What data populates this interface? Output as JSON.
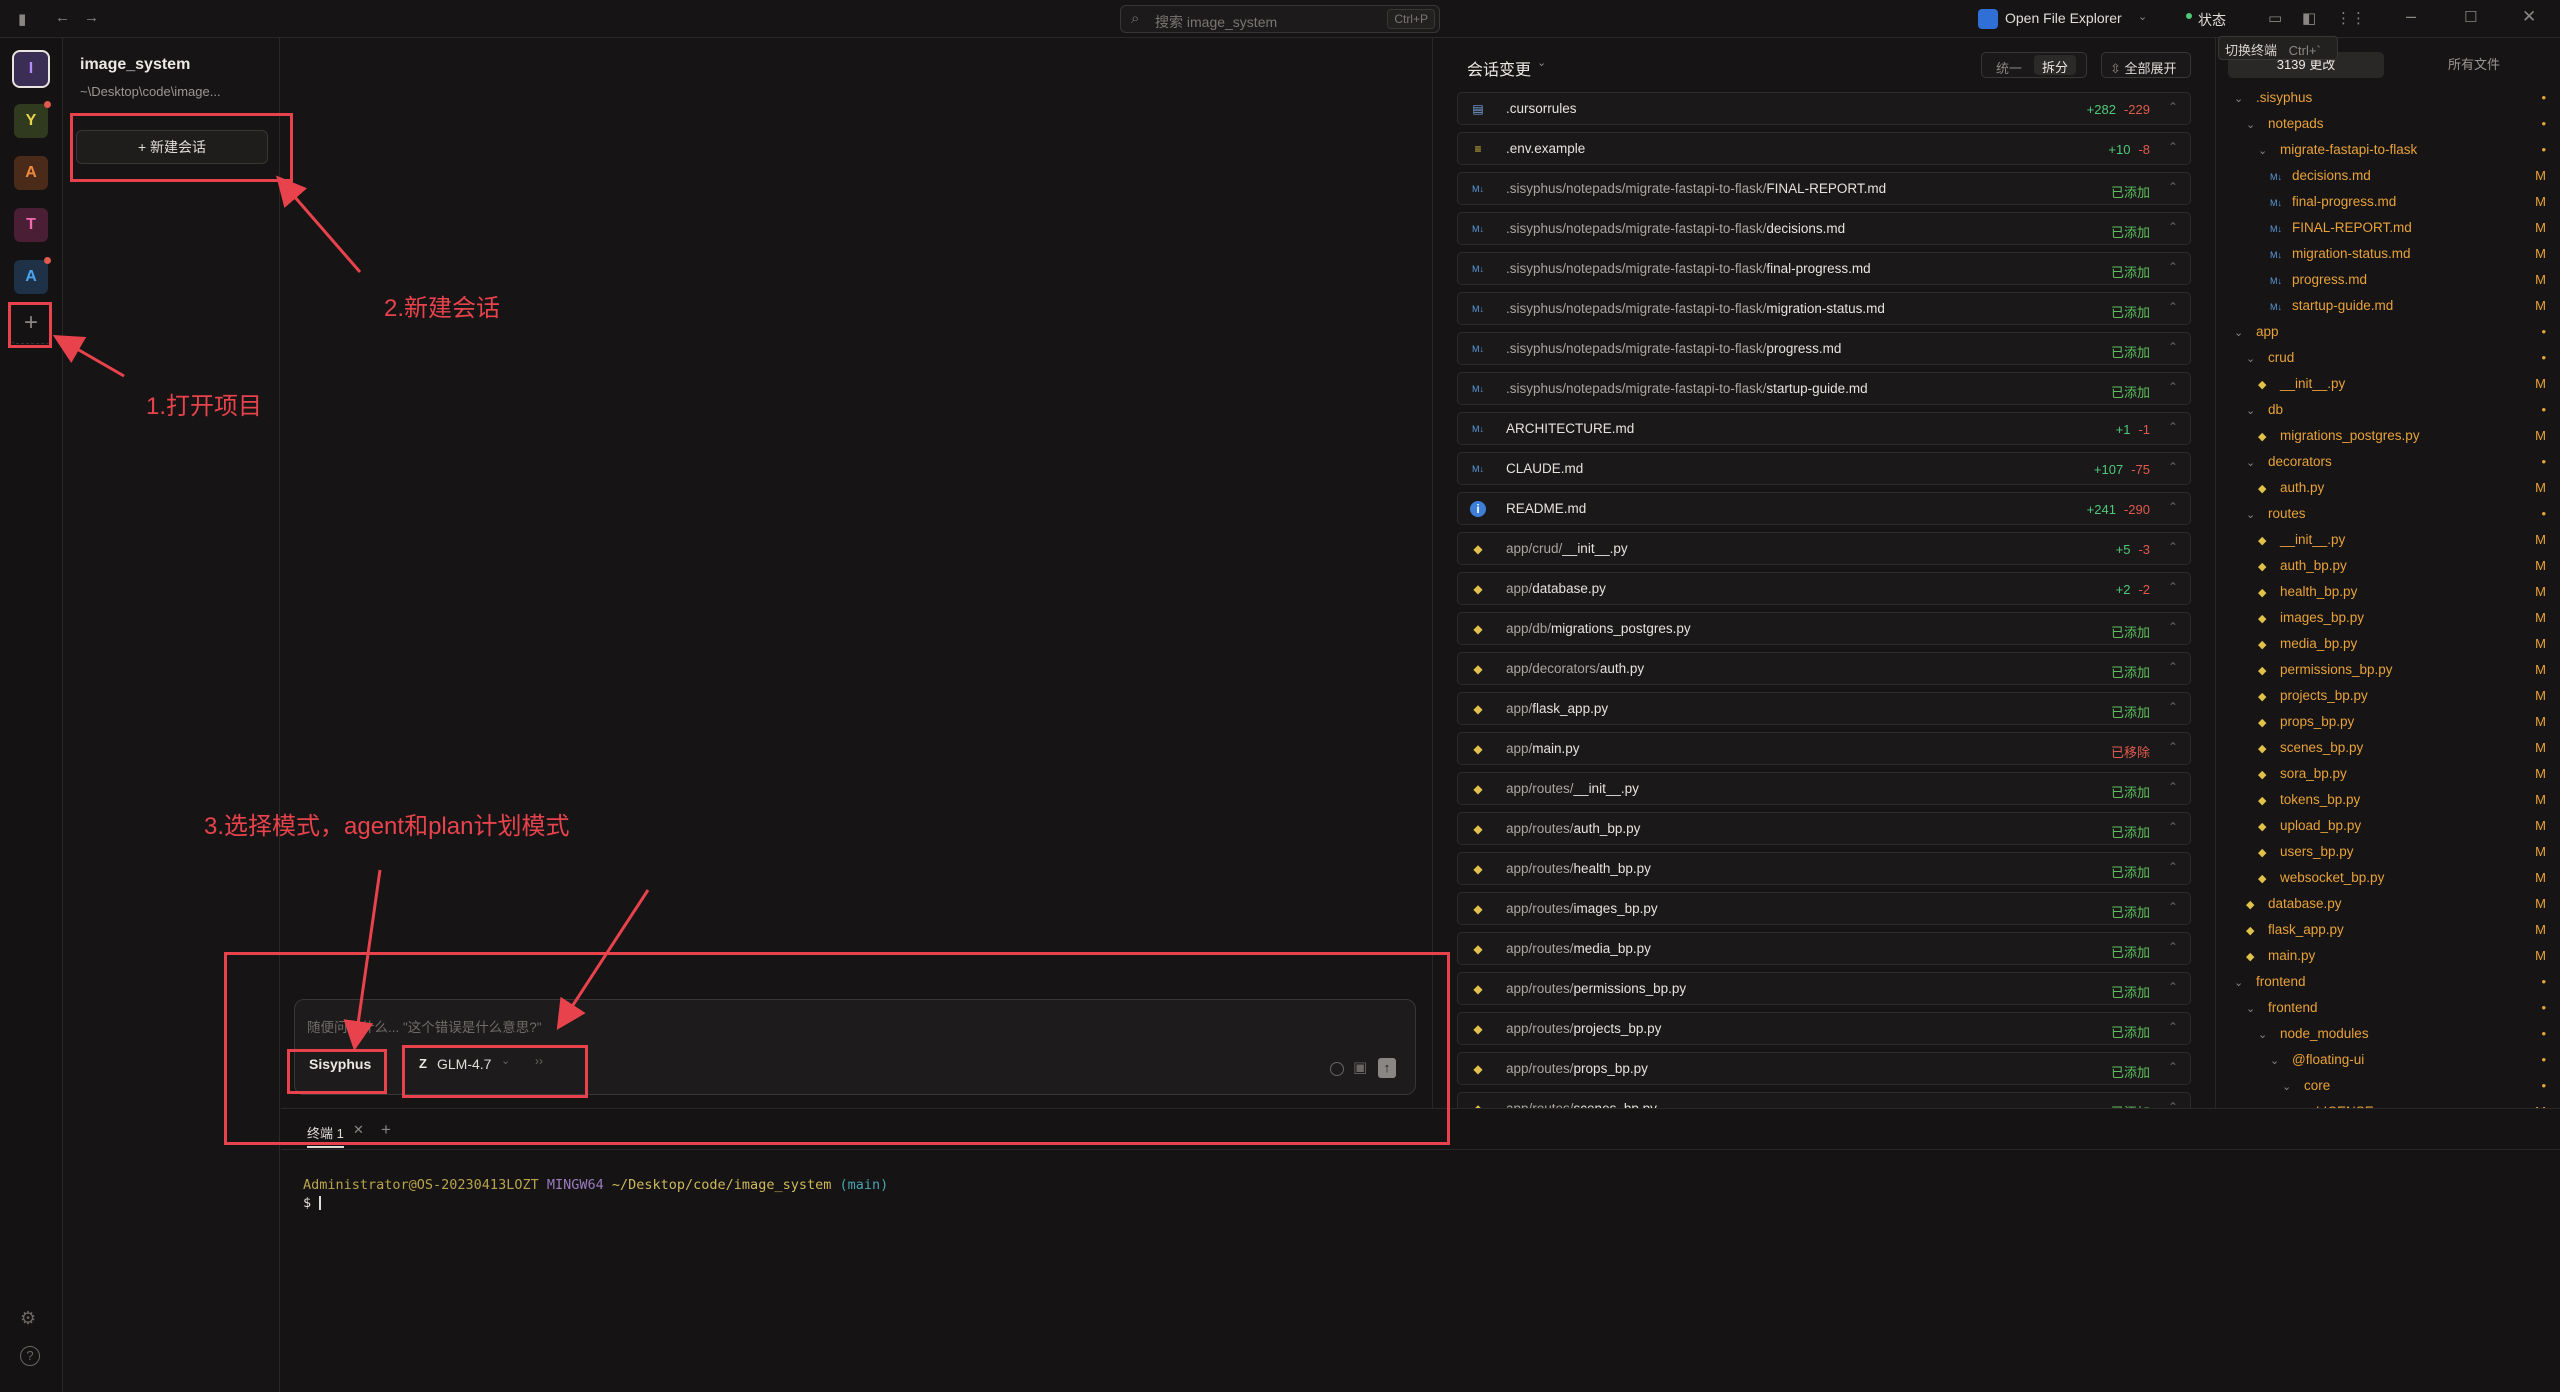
{
  "search": {
    "placeholder": "搜索 image_system",
    "shortcut": "Ctrl+P"
  },
  "titlebar": {
    "explorer_label": "Open File Explorer",
    "status_label": "状态",
    "tooltip_label": "切换终端",
    "tooltip_shortcut": "Ctrl+`"
  },
  "projects": [
    {
      "letter": "I",
      "color": "#b38cff",
      "bg": "#3a2e55"
    },
    {
      "letter": "Y",
      "color": "#e8d34a",
      "bg": "#2f3a1e"
    },
    {
      "letter": "A",
      "color": "#f08a3c",
      "bg": "#4a2a18"
    },
    {
      "letter": "T",
      "color": "#f06ab0",
      "bg": "#4a1e34"
    },
    {
      "letter": "A",
      "color": "#4aa3f0",
      "bg": "#1e3147"
    }
  ],
  "project": {
    "name": "image_system",
    "path": "~\\Desktop\\code\\image..."
  },
  "sessions": {
    "new_label": "+ 新建会话"
  },
  "composer": {
    "placeholder": "随便问点什么... \"这个错误是什么意思?\"",
    "agent": "Sisyphus",
    "model": "GLM-4.7"
  },
  "changes": {
    "title": "会话变更",
    "view_unified": "统一",
    "view_split": "拆分",
    "expand_all": "全部展开",
    "rows": [
      {
        "icon": "file",
        "dir": "",
        "file": ".cursorrules",
        "add": "+282",
        "del": "-229"
      },
      {
        "icon": "env",
        "dir": "",
        "file": ".env.example",
        "add": "+10",
        "del": "-8"
      },
      {
        "icon": "md",
        "dir": ".sisyphus/notepads/migrate-fastapi-to-flask/",
        "file": "FINAL-REPORT.md",
        "status": "已添加"
      },
      {
        "icon": "md",
        "dir": ".sisyphus/notepads/migrate-fastapi-to-flask/",
        "file": "decisions.md",
        "status": "已添加"
      },
      {
        "icon": "md",
        "dir": ".sisyphus/notepads/migrate-fastapi-to-flask/",
        "file": "final-progress.md",
        "status": "已添加"
      },
      {
        "icon": "md",
        "dir": ".sisyphus/notepads/migrate-fastapi-to-flask/",
        "file": "migration-status.md",
        "status": "已添加"
      },
      {
        "icon": "md",
        "dir": ".sisyphus/notepads/migrate-fastapi-to-flask/",
        "file": "progress.md",
        "status": "已添加"
      },
      {
        "icon": "md",
        "dir": ".sisyphus/notepads/migrate-fastapi-to-flask/",
        "file": "startup-guide.md",
        "status": "已添加"
      },
      {
        "icon": "md",
        "dir": "",
        "file": "ARCHITECTURE.md",
        "add": "+1",
        "del": "-1"
      },
      {
        "icon": "md",
        "dir": "",
        "file": "CLAUDE.md",
        "add": "+107",
        "del": "-75"
      },
      {
        "icon": "info",
        "dir": "",
        "file": "README.md",
        "add": "+241",
        "del": "-290"
      },
      {
        "icon": "py",
        "dir": "app/crud/",
        "file": "__init__.py",
        "add": "+5",
        "del": "-3"
      },
      {
        "icon": "py",
        "dir": "app/",
        "file": "database.py",
        "add": "+2",
        "del": "-2"
      },
      {
        "icon": "py",
        "dir": "app/db/",
        "file": "migrations_postgres.py",
        "status": "已添加"
      },
      {
        "icon": "py",
        "dir": "app/decorators/",
        "file": "auth.py",
        "status": "已添加"
      },
      {
        "icon": "py",
        "dir": "app/",
        "file": "flask_app.py",
        "status": "已添加"
      },
      {
        "icon": "py",
        "dir": "app/",
        "file": "main.py",
        "status": "已移除",
        "removed": true
      },
      {
        "icon": "py",
        "dir": "app/routes/",
        "file": "__init__.py",
        "status": "已添加"
      },
      {
        "icon": "py",
        "dir": "app/routes/",
        "file": "auth_bp.py",
        "status": "已添加"
      },
      {
        "icon": "py",
        "dir": "app/routes/",
        "file": "health_bp.py",
        "status": "已添加"
      },
      {
        "icon": "py",
        "dir": "app/routes/",
        "file": "images_bp.py",
        "status": "已添加"
      },
      {
        "icon": "py",
        "dir": "app/routes/",
        "file": "media_bp.py",
        "status": "已添加"
      },
      {
        "icon": "py",
        "dir": "app/routes/",
        "file": "permissions_bp.py",
        "status": "已添加"
      },
      {
        "icon": "py",
        "dir": "app/routes/",
        "file": "projects_bp.py",
        "status": "已添加"
      },
      {
        "icon": "py",
        "dir": "app/routes/",
        "file": "props_bp.py",
        "status": "已添加"
      },
      {
        "icon": "py",
        "dir": "app/routes/",
        "file": "scenes_bp.py",
        "status": "已添加"
      }
    ]
  },
  "tree": {
    "tab_changes": "3139 更改",
    "tab_all": "所有文件",
    "nodes": [
      {
        "name": ".sisyphus",
        "type": "folder",
        "depth": 0,
        "mark": "•"
      },
      {
        "name": "notepads",
        "type": "folder",
        "depth": 1,
        "mark": "•"
      },
      {
        "name": "migrate-fastapi-to-flask",
        "type": "folder",
        "depth": 2,
        "mark": "•"
      },
      {
        "name": "decisions.md",
        "type": "md",
        "depth": 3,
        "mark": "M"
      },
      {
        "name": "final-progress.md",
        "type": "md",
        "depth": 3,
        "mark": "M"
      },
      {
        "name": "FINAL-REPORT.md",
        "type": "md",
        "depth": 3,
        "mark": "M"
      },
      {
        "name": "migration-status.md",
        "type": "md",
        "depth": 3,
        "mark": "M"
      },
      {
        "name": "progress.md",
        "type": "md",
        "depth": 3,
        "mark": "M"
      },
      {
        "name": "startup-guide.md",
        "type": "md",
        "depth": 3,
        "mark": "M"
      },
      {
        "name": "app",
        "type": "folder",
        "depth": 0,
        "mark": "•"
      },
      {
        "name": "crud",
        "type": "folder",
        "depth": 1,
        "mark": "•"
      },
      {
        "name": "__init__.py",
        "type": "py",
        "depth": 2,
        "mark": "M"
      },
      {
        "name": "db",
        "type": "folder",
        "depth": 1,
        "mark": "•"
      },
      {
        "name": "migrations_postgres.py",
        "type": "py",
        "depth": 2,
        "mark": "M"
      },
      {
        "name": "decorators",
        "type": "folder",
        "depth": 1,
        "mark": "•"
      },
      {
        "name": "auth.py",
        "type": "py",
        "depth": 2,
        "mark": "M"
      },
      {
        "name": "routes",
        "type": "folder",
        "depth": 1,
        "mark": "•"
      },
      {
        "name": "__init__.py",
        "type": "py",
        "depth": 2,
        "mark": "M"
      },
      {
        "name": "auth_bp.py",
        "type": "py",
        "depth": 2,
        "mark": "M"
      },
      {
        "name": "health_bp.py",
        "type": "py",
        "depth": 2,
        "mark": "M"
      },
      {
        "name": "images_bp.py",
        "type": "py",
        "depth": 2,
        "mark": "M"
      },
      {
        "name": "media_bp.py",
        "type": "py",
        "depth": 2,
        "mark": "M"
      },
      {
        "name": "permissions_bp.py",
        "type": "py",
        "depth": 2,
        "mark": "M"
      },
      {
        "name": "projects_bp.py",
        "type": "py",
        "depth": 2,
        "mark": "M"
      },
      {
        "name": "props_bp.py",
        "type": "py",
        "depth": 2,
        "mark": "M"
      },
      {
        "name": "scenes_bp.py",
        "type": "py",
        "depth": 2,
        "mark": "M"
      },
      {
        "name": "sora_bp.py",
        "type": "py",
        "depth": 2,
        "mark": "M"
      },
      {
        "name": "tokens_bp.py",
        "type": "py",
        "depth": 2,
        "mark": "M"
      },
      {
        "name": "upload_bp.py",
        "type": "py",
        "depth": 2,
        "mark": "M"
      },
      {
        "name": "users_bp.py",
        "type": "py",
        "depth": 2,
        "mark": "M"
      },
      {
        "name": "websocket_bp.py",
        "type": "py",
        "depth": 2,
        "mark": "M"
      },
      {
        "name": "database.py",
        "type": "py",
        "depth": 1,
        "mark": "M"
      },
      {
        "name": "flask_app.py",
        "type": "py",
        "depth": 1,
        "mark": "M"
      },
      {
        "name": "main.py",
        "type": "py",
        "depth": 1,
        "mark": "M"
      },
      {
        "name": "frontend",
        "type": "folder",
        "depth": 0,
        "mark": "•"
      },
      {
        "name": "frontend",
        "type": "folder",
        "depth": 1,
        "mark": "•"
      },
      {
        "name": "node_modules",
        "type": "folder",
        "depth": 2,
        "mark": "•"
      },
      {
        "name": "@floating-ui",
        "type": "folder",
        "depth": 3,
        "mark": "•"
      },
      {
        "name": "core",
        "type": "folder",
        "depth": 4,
        "mark": "•"
      },
      {
        "name": "LICENSE",
        "type": "file",
        "depth": 5,
        "mark": "M"
      }
    ]
  },
  "terminal": {
    "tab": "终端 1",
    "user": "Administrator@OS-20230413LOZT",
    "shell": "MINGW64",
    "cwd": "~/Desktop/code/image_system",
    "branch": "(main)",
    "prompt": "$"
  },
  "annotations": {
    "step1": "1.打开项目",
    "step2": "2.新建会话",
    "step3": "3.选择模式，agent和plan计划模式"
  },
  "colors": {
    "accent_red": "#e8434d",
    "add_green": "#4ec97a",
    "del_red": "#e05a4e",
    "added_status": "#5fbf5f",
    "tree_orange": "#e8a23a"
  }
}
